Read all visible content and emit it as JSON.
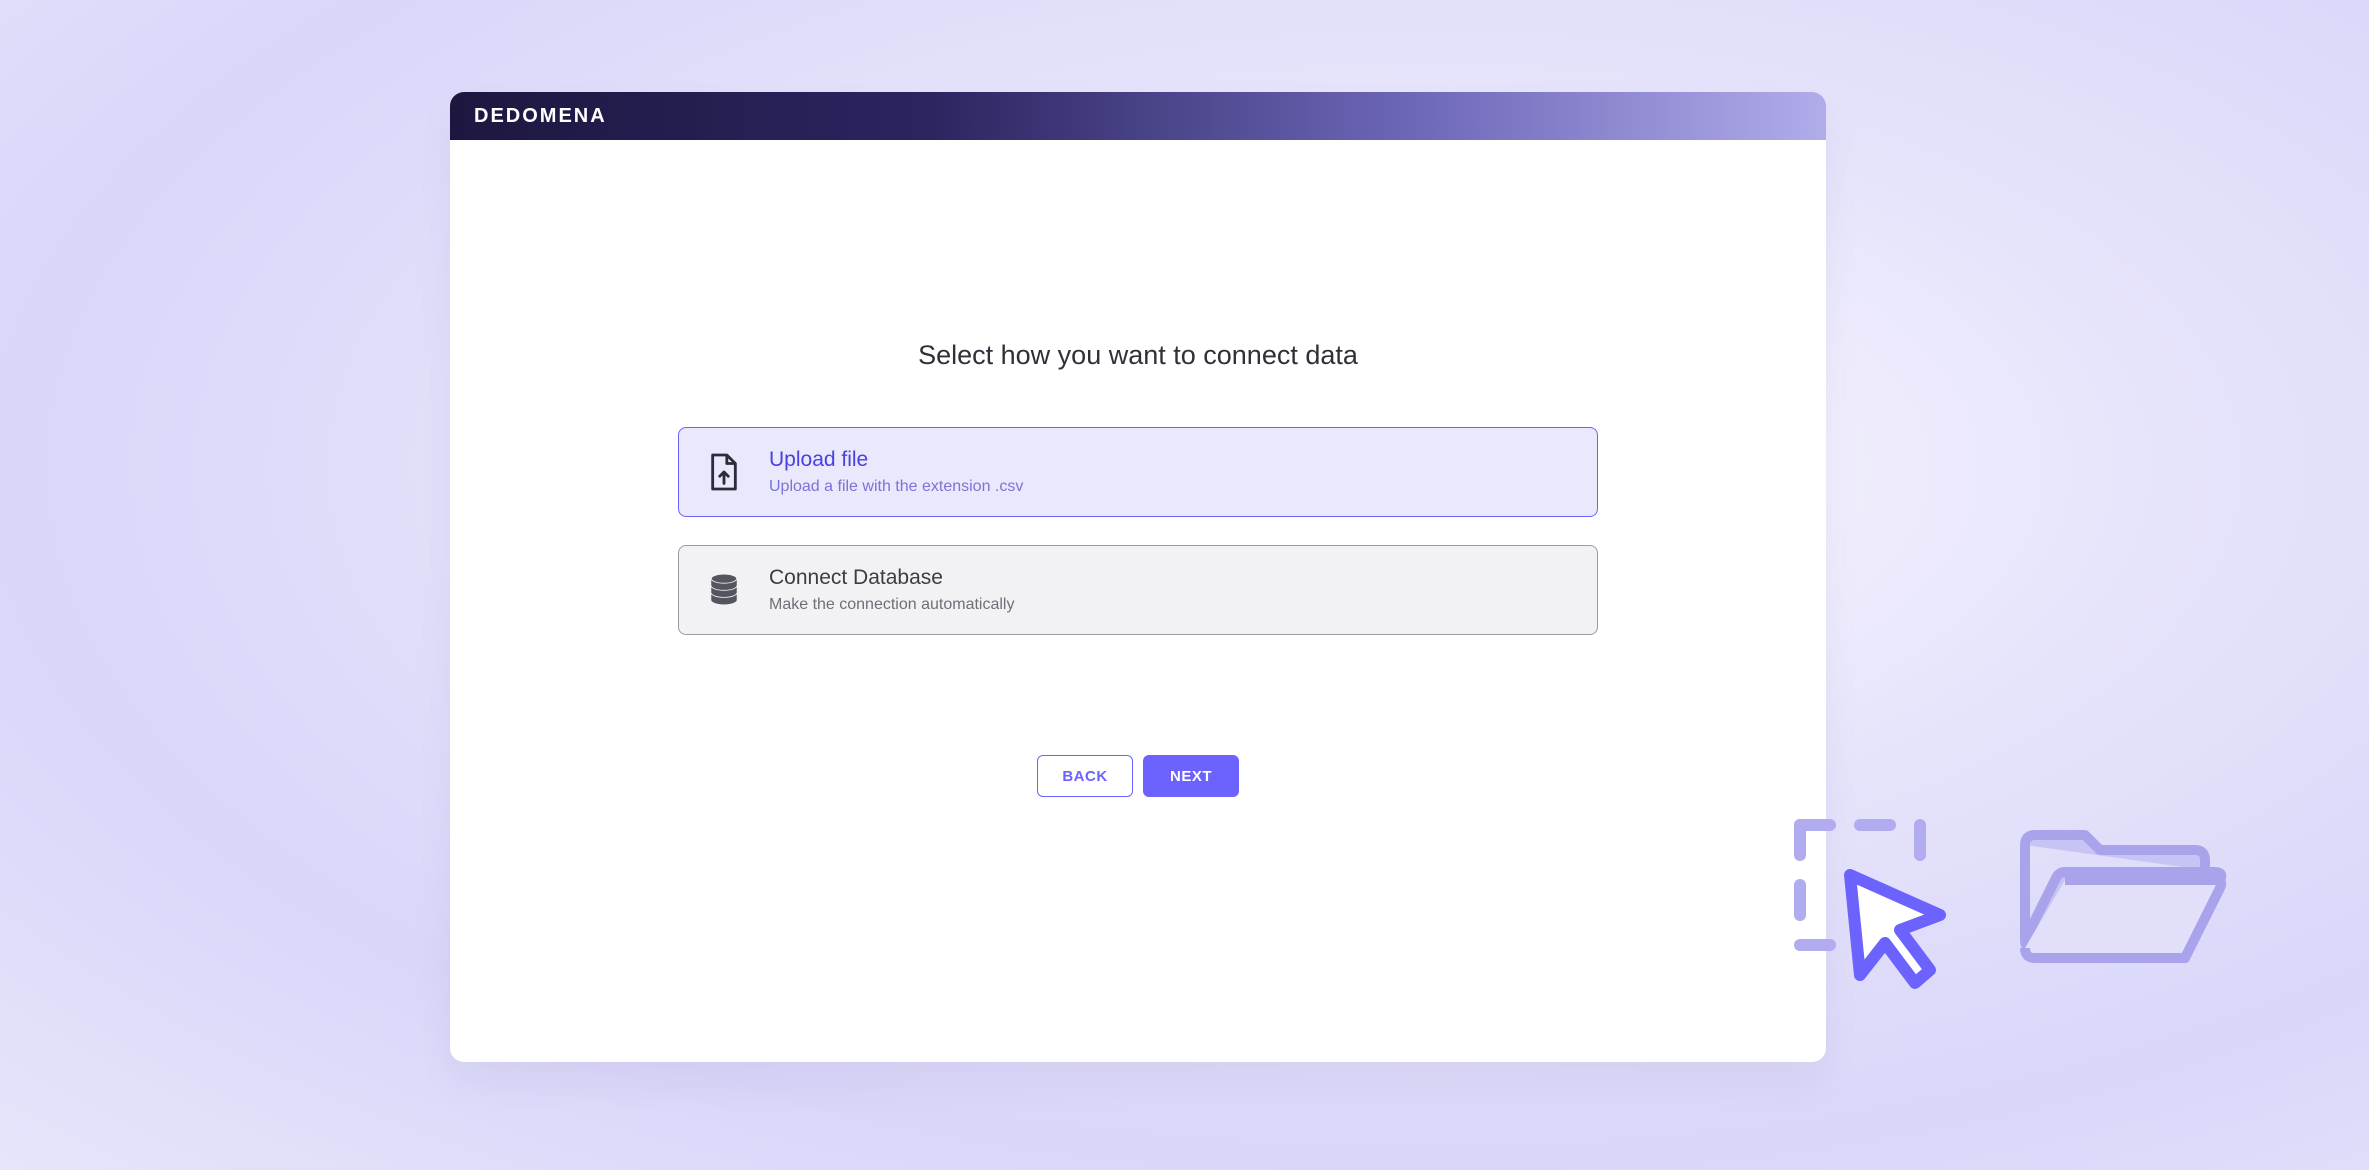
{
  "brand": "DEDOMENA",
  "heading": "Select how you want to connect data",
  "options": {
    "upload": {
      "title": "Upload file",
      "subtitle": "Upload a file with the extension .csv"
    },
    "database": {
      "title": "Connect Database",
      "subtitle": "Make the connection automatically"
    }
  },
  "buttons": {
    "back": "BACK",
    "next": "NEXT"
  }
}
